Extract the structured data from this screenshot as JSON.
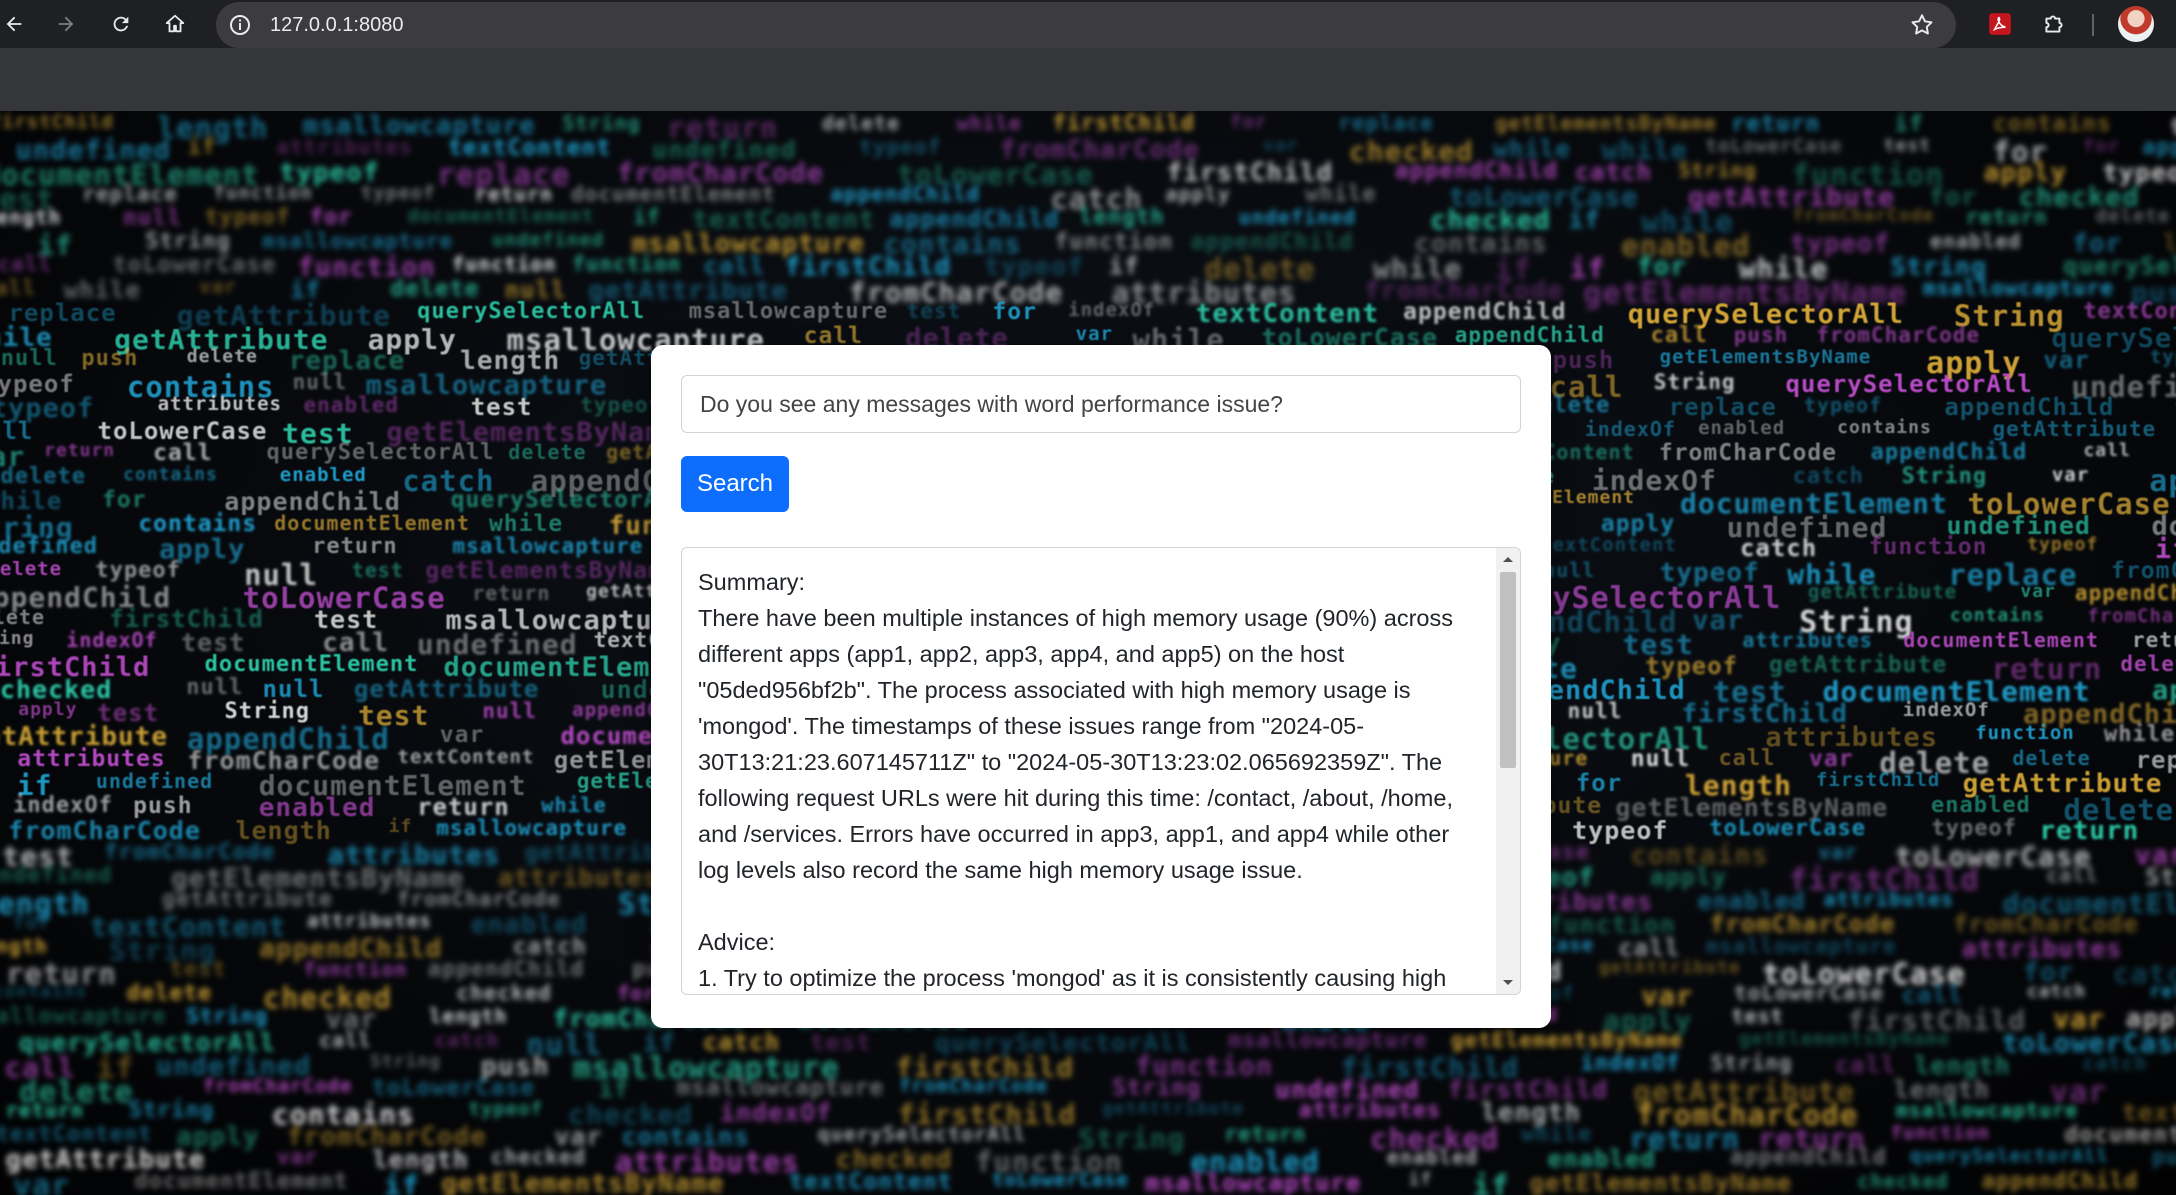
{
  "browser": {
    "url": "127.0.0.1:8080",
    "icons": {
      "back": "back-arrow-icon",
      "forward": "forward-arrow-icon",
      "reload": "reload-icon",
      "home": "home-icon",
      "site_info": "info-icon",
      "bookmark": "star-icon",
      "pdf_extension": "pdf-icon",
      "extensions": "puzzle-icon",
      "profile": "avatar"
    }
  },
  "search": {
    "query_value": "Do you see any messages with word performance issue?",
    "button_label": "Search"
  },
  "result": {
    "text": "Summary:\nThere have been multiple instances of high memory usage (90%) across different apps (app1, app2, app3, app4, and app5) on the host \"05ded956bf2b\". The process associated with high memory usage is 'mongod'. The timestamps of these issues range from \"2024-05-30T13:21:23.607145711Z\" to \"2024-05-30T13:23:02.065692359Z\". The following request URLs were hit during this time: /contact, /about, /home, and /services. Errors have occurred in app3, app1, and app4 while other log levels also record the same high memory usage issue.\n\nAdvice:\n1. Try to optimize the process 'mongod' as it is consistently causing high"
  },
  "colors": {
    "accent": "#0d6efd",
    "chrome_toolbar": "#1f2023",
    "chrome_strip": "#35363a",
    "code_cyan": "#21a6d6",
    "code_yellow": "#e6b43a",
    "code_white": "#e9e9e9",
    "code_teal": "#2fd3b0",
    "code_magenta": "#c34fd1"
  }
}
